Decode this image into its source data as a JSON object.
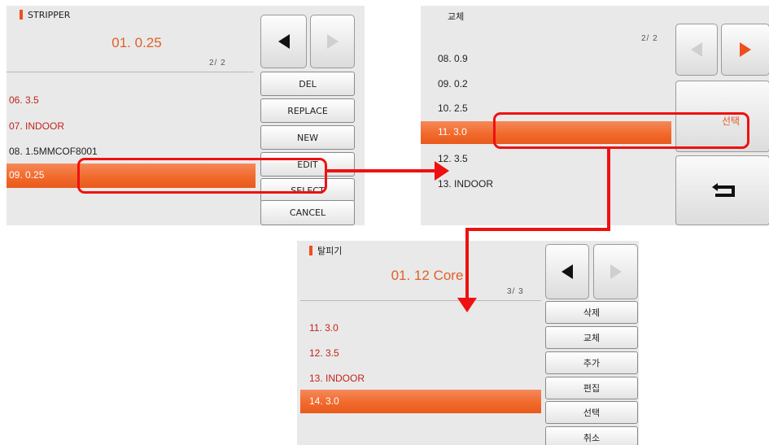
{
  "screen1": {
    "title": "STRIPPER",
    "current": "01. 0.25",
    "page": "2/ 2",
    "items": [
      {
        "label": "06. 3.5"
      },
      {
        "label": "07. INDOOR"
      },
      {
        "label": "08. 1.5MMCOF8001"
      },
      {
        "label": "09. 0.25"
      }
    ],
    "buttons": [
      "DEL",
      "REPLACE",
      "NEW",
      "EDIT",
      "SELECT",
      "CANCEL"
    ]
  },
  "screen2": {
    "title": "교체",
    "page": "2/ 2",
    "items": [
      {
        "label": "08. 0.9"
      },
      {
        "label": "09. 0.2"
      },
      {
        "label": "10. 2.5"
      },
      {
        "label": "11. 3.0"
      },
      {
        "label": "12. 3.5"
      },
      {
        "label": "13. INDOOR"
      }
    ],
    "select_button": "선택"
  },
  "screen3": {
    "title": "탈피기",
    "current": "01. 12 Core",
    "page": "3/ 3",
    "items": [
      {
        "label": "11. 3.0"
      },
      {
        "label": "12. 3.5"
      },
      {
        "label": "13. INDOOR"
      },
      {
        "label": "14. 3.0"
      }
    ],
    "buttons": [
      "삭제",
      "교체",
      "추가",
      "편집",
      "선택",
      "취소"
    ]
  },
  "colors": {
    "accent": "#f16a2c",
    "highlight": "#ee1111",
    "item_red": "#c2231b"
  },
  "icons": [
    "arrow-left-icon",
    "arrow-right-icon",
    "return-icon"
  ]
}
